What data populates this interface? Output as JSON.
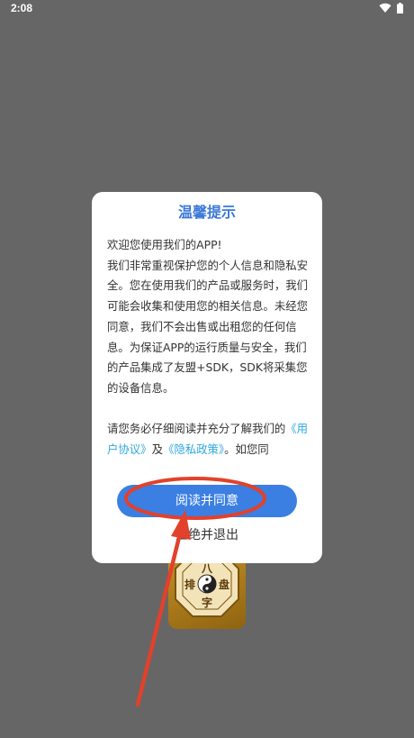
{
  "status_bar": {
    "time": "2:08",
    "icons": [
      "wifi-icon",
      "battery-icon"
    ]
  },
  "background": {
    "logo_chars": [
      "八",
      "排",
      "盘",
      "字"
    ]
  },
  "dialog": {
    "title": "温馨提示",
    "paragraphs": [
      "欢迎您使用我们的APP!",
      "我们非常重视保护您的个人信息和隐私安全。您在使用我们的产品或服务时，我们可能会收集和使用您的相关信息。未经您同意，我们不会出售或出租您的任何信息。为保证APP的运行质量与安全，我们的产品集成了友盟+SDK，SDK将采集您的设备信息。"
    ],
    "consent_prefix": "请您务必仔细阅读并充分了解我们的",
    "user_agreement_link": "《用户协议》",
    "and_text": "及",
    "privacy_policy_link": "《隐私政策》",
    "consent_suffix": "。如您同",
    "agree_button": "阅读并同意",
    "reject_button": "拒绝并退出"
  },
  "colors": {
    "overlay": "#666666",
    "title": "#3a78d8",
    "link": "#2ea8e0",
    "button": "#3b7fe3",
    "annotation": "#e2412b"
  }
}
